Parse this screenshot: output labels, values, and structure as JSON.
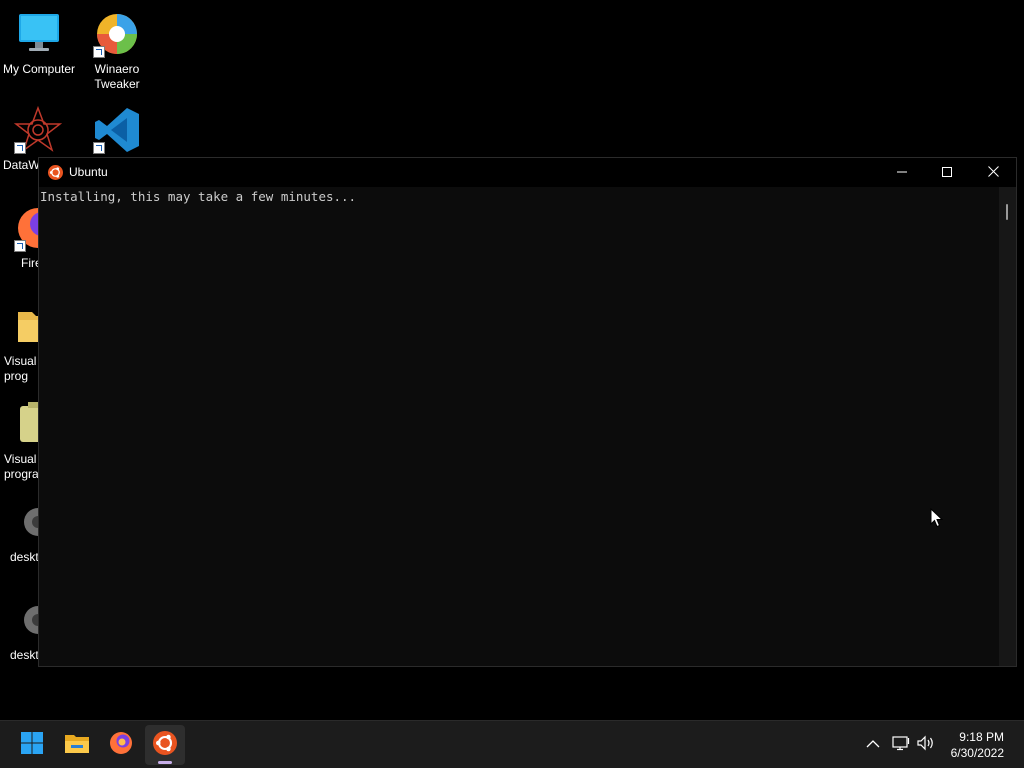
{
  "desktop": {
    "icons": [
      {
        "label": "My Computer",
        "icon": "monitor-icon"
      },
      {
        "label": "Winaero Tweaker",
        "icon": "winaero-tweaker-icon"
      },
      {
        "label": "DataW",
        "icon": "datawrangler-icon"
      },
      {
        "label": "",
        "icon": "vscode-icon"
      },
      {
        "label": "Fire",
        "icon": "firefox-icon"
      },
      {
        "label": "Visual prog",
        "icon": "folder-icon"
      },
      {
        "label": "Visual progra",
        "icon": "archive-icon"
      },
      {
        "label": "deskt",
        "icon": "gear-icon"
      },
      {
        "label": "deskt",
        "icon": "gear-icon"
      }
    ]
  },
  "window": {
    "title": "Ubuntu",
    "console_text": "Installing, this may take a few minutes...",
    "buttons": {
      "minimize": "minimize-icon",
      "maximize": "maximize-icon",
      "close": "close-icon"
    }
  },
  "taskbar": {
    "apps": [
      {
        "name": "Start",
        "icon": "windows-start-icon"
      },
      {
        "name": "File Explorer",
        "icon": "file-explorer-icon"
      },
      {
        "name": "Firefox",
        "icon": "firefox-icon"
      },
      {
        "name": "Ubuntu",
        "icon": "ubuntu-icon",
        "active": true
      }
    ],
    "tray": {
      "chevron": "chevron-up-icon",
      "network": "network-icon",
      "volume": "volume-icon"
    },
    "clock": {
      "time": "9:18 PM",
      "date": "6/30/2022"
    }
  },
  "colors": {
    "ubuntu_orange": "#e95420",
    "console_bg": "#0c0c0c",
    "taskbar_bg": "#1c1c1c",
    "accent_indicator": "#c7aee8"
  }
}
